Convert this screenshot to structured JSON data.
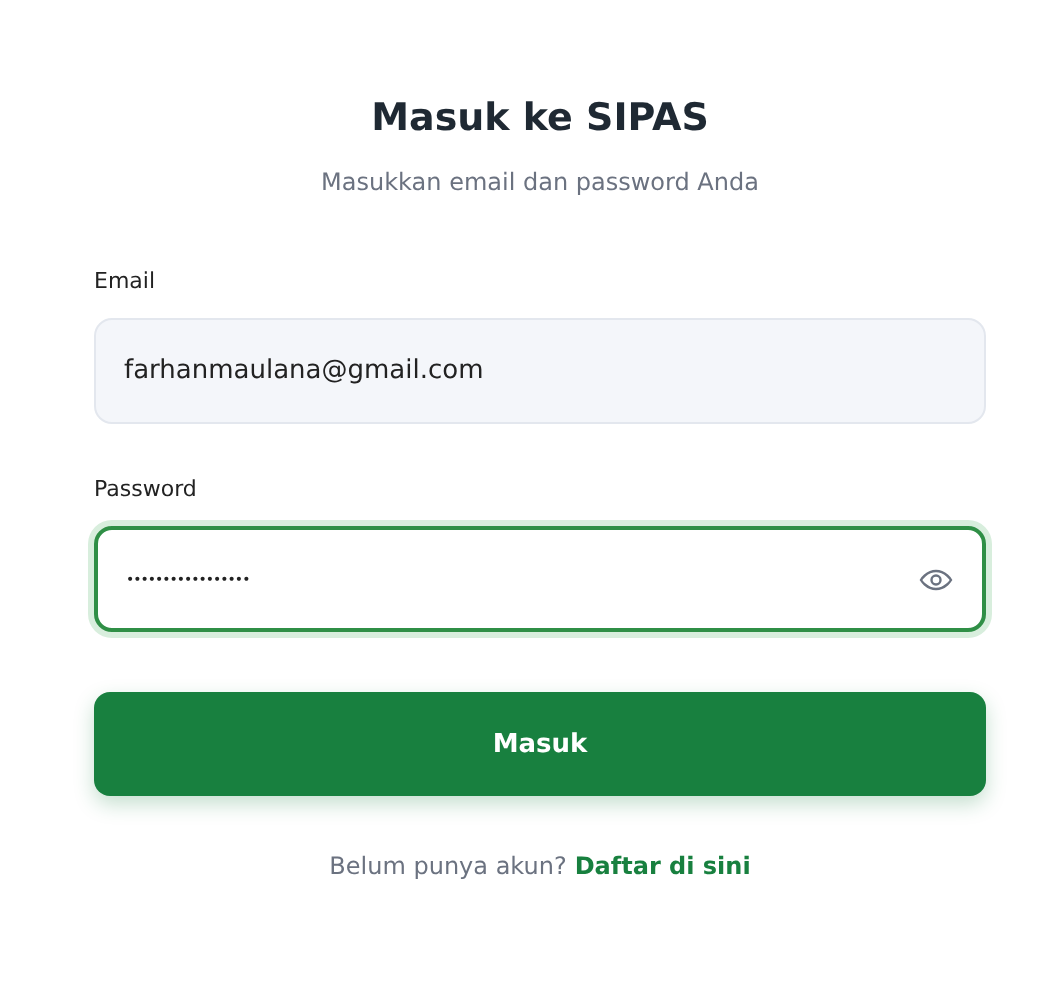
{
  "title": "Masuk ke SIPAS",
  "subtitle": "Masukkan email dan password Anda",
  "fields": [
    {
      "label": "Email",
      "value": "farhanmaulana@gmail.com",
      "focused": false,
      "kind": "text"
    },
    {
      "label": "Password",
      "value": "•••••••••••••••••",
      "focused": true,
      "kind": "password"
    }
  ],
  "submit": "Masuk",
  "footer": {
    "text": "Belum punya akun?",
    "link": "Daftar di sini"
  }
}
